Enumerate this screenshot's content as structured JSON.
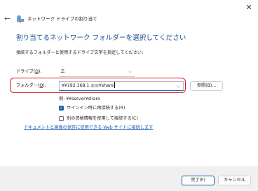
{
  "window": {
    "close_icon": "close-icon",
    "back_icon": "back-arrow-icon",
    "title": "ネットワーク ドライブの割り当て"
  },
  "main": {
    "heading": "割り当てるネットワーク フォルダーを選択してください",
    "instruction": "接続するフォルダーと使用するドライブ文字を指定してください:",
    "drive": {
      "label_pre": "ドライブ(",
      "label_key": "D",
      "label_post": "):",
      "value": "Z:"
    },
    "folder": {
      "label_pre": "フォルダー(",
      "label_key": "O",
      "label_post": "):",
      "value": "¥¥192.168.1.",
      "value_masked": "■■",
      "value_suffix": "¥share"
    },
    "browse_label": "参照(B)...",
    "example": "例: ¥¥server¥share",
    "reconnect_label": "サインイン時に再接続する(R)",
    "reconnect_checked": true,
    "other_credentials_label": "別の資格情報を使用して接続する(C)",
    "other_credentials_checked": false,
    "link_text": "ドキュメントと画像の保存に使用できる Web サイトに接続します"
  },
  "footer": {
    "finish_label": "完了(F)",
    "cancel_label": "キャンセル"
  },
  "colors": {
    "heading": "#1c4e8f",
    "accent": "#1f5fa8",
    "highlight": "#e0121b",
    "link": "#1a5fb4"
  }
}
